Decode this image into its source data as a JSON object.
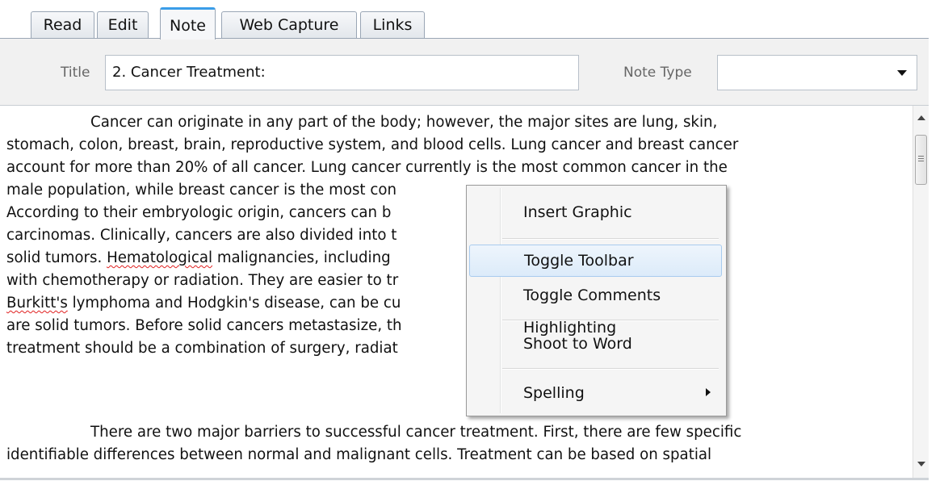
{
  "tabs": [
    {
      "label": "Read",
      "active": false
    },
    {
      "label": "Edit",
      "active": false
    },
    {
      "label": "Note",
      "active": true
    },
    {
      "label": "Web Capture",
      "active": false
    },
    {
      "label": "Links",
      "active": false
    }
  ],
  "header": {
    "title_label": "Title",
    "title_value": "2.  Cancer Treatment:",
    "note_type_label": "Note Type",
    "note_type_value": ""
  },
  "content": {
    "paragraph1": {
      "line1": "Cancer can originate in any part of the body; however, the major sites are lung, skin,",
      "line2": "stomach, colon, breast, brain, reproductive system, and blood cells. Lung cancer and breast cancer",
      "line3": "account for more than 20% of all cancer. Lung cancer currently is the most common cancer in the",
      "line4": "male population, while breast cancer is the most con",
      "line5": "According to their embryologic origin, cancers can b",
      "line6": "carcinomas. Clinically, cancers are also divided into t",
      "line7_pre": "solid tumors. ",
      "line7_misspelled": "Hematological",
      "line7_post": " malignancies, including",
      "line8": "with chemotherapy or radiation. They are easier to tr",
      "line9_misspelled": "Burkitt's",
      "line9_post": " lymphoma and Hodgkin's disease, can be cu",
      "line10": "are solid tumors. Before solid cancers metastasize, th",
      "line11": "treatment should be a combination of surgery, radiat"
    },
    "paragraph2": {
      "line1": "There are two major barriers to successful cancer treatment. First, there are few specific",
      "line2": "identifiable differences between normal and malignant cells. Treatment can be based on spatial"
    }
  },
  "context_menu": {
    "items": [
      {
        "label": "Insert Graphic",
        "highlighted": false,
        "submenu": false
      },
      {
        "label": "Toggle Toolbar",
        "highlighted": true,
        "submenu": false
      },
      {
        "label": "Toggle Comments Highlighting",
        "highlighted": false,
        "submenu": false
      },
      {
        "label": "Shoot to Word",
        "highlighted": false,
        "submenu": false
      },
      {
        "label": "Spelling",
        "highlighted": false,
        "submenu": true
      }
    ]
  },
  "icons": {
    "dropdown": "chevron-down-icon",
    "scroll_up": "scroll-up-arrow-icon",
    "scroll_down": "scroll-down-arrow-icon",
    "submenu": "submenu-arrow-icon"
  },
  "colors": {
    "active_tab_accent": "#3a9de8",
    "menu_highlight": "#dcebfa",
    "spelling_underline": "#e02020"
  }
}
